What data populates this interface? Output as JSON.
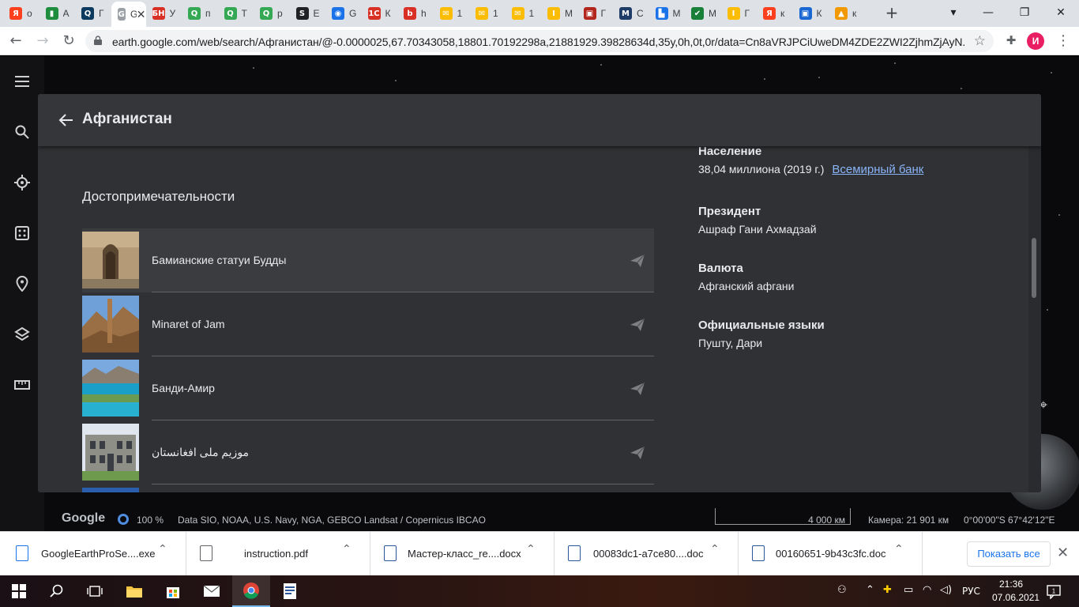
{
  "browser": {
    "tabs": [
      {
        "label": "о",
        "fav_text": "Я",
        "fav_color": "#fc3f1d"
      },
      {
        "label": "А",
        "fav_text": "▮",
        "fav_color": "#1e8e3e"
      },
      {
        "label": "Г",
        "fav_text": "Q",
        "fav_color": "#0b3a5e"
      },
      {
        "label": "Gt",
        "fav_text": "G",
        "fav_color": "#9aa0a6",
        "active": true
      },
      {
        "label": "У",
        "fav_text": "БН",
        "fav_color": "#d93025"
      },
      {
        "label": "п",
        "fav_text": "Q",
        "fav_color": "#34a853"
      },
      {
        "label": "Т",
        "fav_text": "Q",
        "fav_color": "#34a853"
      },
      {
        "label": "р",
        "fav_text": "Q",
        "fav_color": "#34a853"
      },
      {
        "label": "Е",
        "fav_text": "S",
        "fav_color": "#202124"
      },
      {
        "label": "G",
        "fav_text": "◉",
        "fav_color": "#1a73e8"
      },
      {
        "label": "К",
        "fav_text": "1С",
        "fav_color": "#d93025"
      },
      {
        "label": "h",
        "fav_text": "b",
        "fav_color": "#d93025"
      },
      {
        "label": "1",
        "fav_text": "✉",
        "fav_color": "#fbbc04"
      },
      {
        "label": "1",
        "fav_text": "✉",
        "fav_color": "#fbbc04"
      },
      {
        "label": "1",
        "fav_text": "✉",
        "fav_color": "#fbbc04"
      },
      {
        "label": "М",
        "fav_text": "I",
        "fav_color": "#fbbc04"
      },
      {
        "label": "Г",
        "fav_text": "▣",
        "fav_color": "#b3261e"
      },
      {
        "label": "С",
        "fav_text": "M",
        "fav_color": "#1f3b68"
      },
      {
        "label": "М",
        "fav_text": "▙",
        "fav_color": "#1a73e8"
      },
      {
        "label": "М",
        "fav_text": "✔",
        "fav_color": "#188038"
      },
      {
        "label": "Г",
        "fav_text": "I",
        "fav_color": "#fbbc04"
      },
      {
        "label": "к",
        "fav_text": "Я",
        "fav_color": "#fc3f1d"
      },
      {
        "label": "К",
        "fav_text": "▣",
        "fav_color": "#1967d2"
      },
      {
        "label": "к",
        "fav_text": "▲",
        "fav_color": "#f29900"
      }
    ],
    "url": "earth.google.com/web/search/Афганистан/@-0.0000025,67.70343058,18801.70192298a,21881929.39828634d,35y,0h,0t,0r/data=Cn8aVRJPCiUweDM4ZDE2ZWI2ZjhmZjAyN...",
    "profile_initial": "И"
  },
  "earth": {
    "panel": {
      "title": "Афганистан",
      "section_title": "Достопримечательности",
      "places": [
        {
          "name": "Бамианские статуи Будды"
        },
        {
          "name": "Minaret of Jam"
        },
        {
          "name": "Банди-Амир"
        },
        {
          "name": "موزیم ملی افغانستان"
        }
      ],
      "facts": {
        "population_label": "Население",
        "population_value": "38,04 миллиона (2019 г.)",
        "population_source": "Всемирный банк",
        "president_label": "Президент",
        "president_value": "Ашраф Гани Ахмадзай",
        "currency_label": "Валюта",
        "currency_value": "Афганский афгани",
        "languages_label": "Официальные языки",
        "languages_value": "Пушту, Дари"
      }
    },
    "status": {
      "logo": "Google",
      "zoom": "100 %",
      "credits": "Data SIO, NOAA, U.S. Navy, NGA, GEBCO   Landsat / Copernicus   IBCAO",
      "scale": "4 000 км",
      "camera": "Камера: 21 901 км",
      "coords": "0°00'00\"S 67°42'12\"E"
    }
  },
  "downloads": {
    "items": [
      {
        "name": "GoogleEarthProSe....exe"
      },
      {
        "name": "instruction.pdf"
      },
      {
        "name": "Мастер-класс_re....docx"
      },
      {
        "name": "00083dc1-a7ce80....doc"
      },
      {
        "name": "00160651-9b43c3fc.doc"
      }
    ],
    "show_all": "Показать все"
  },
  "taskbar": {
    "language": "РУС",
    "time": "21:36",
    "date": "07.06.2021",
    "notification_count": "1"
  },
  "colors": {
    "panel_bg": "#303134",
    "link": "#8ab4f8",
    "accent_blue": "#1a73e8"
  }
}
